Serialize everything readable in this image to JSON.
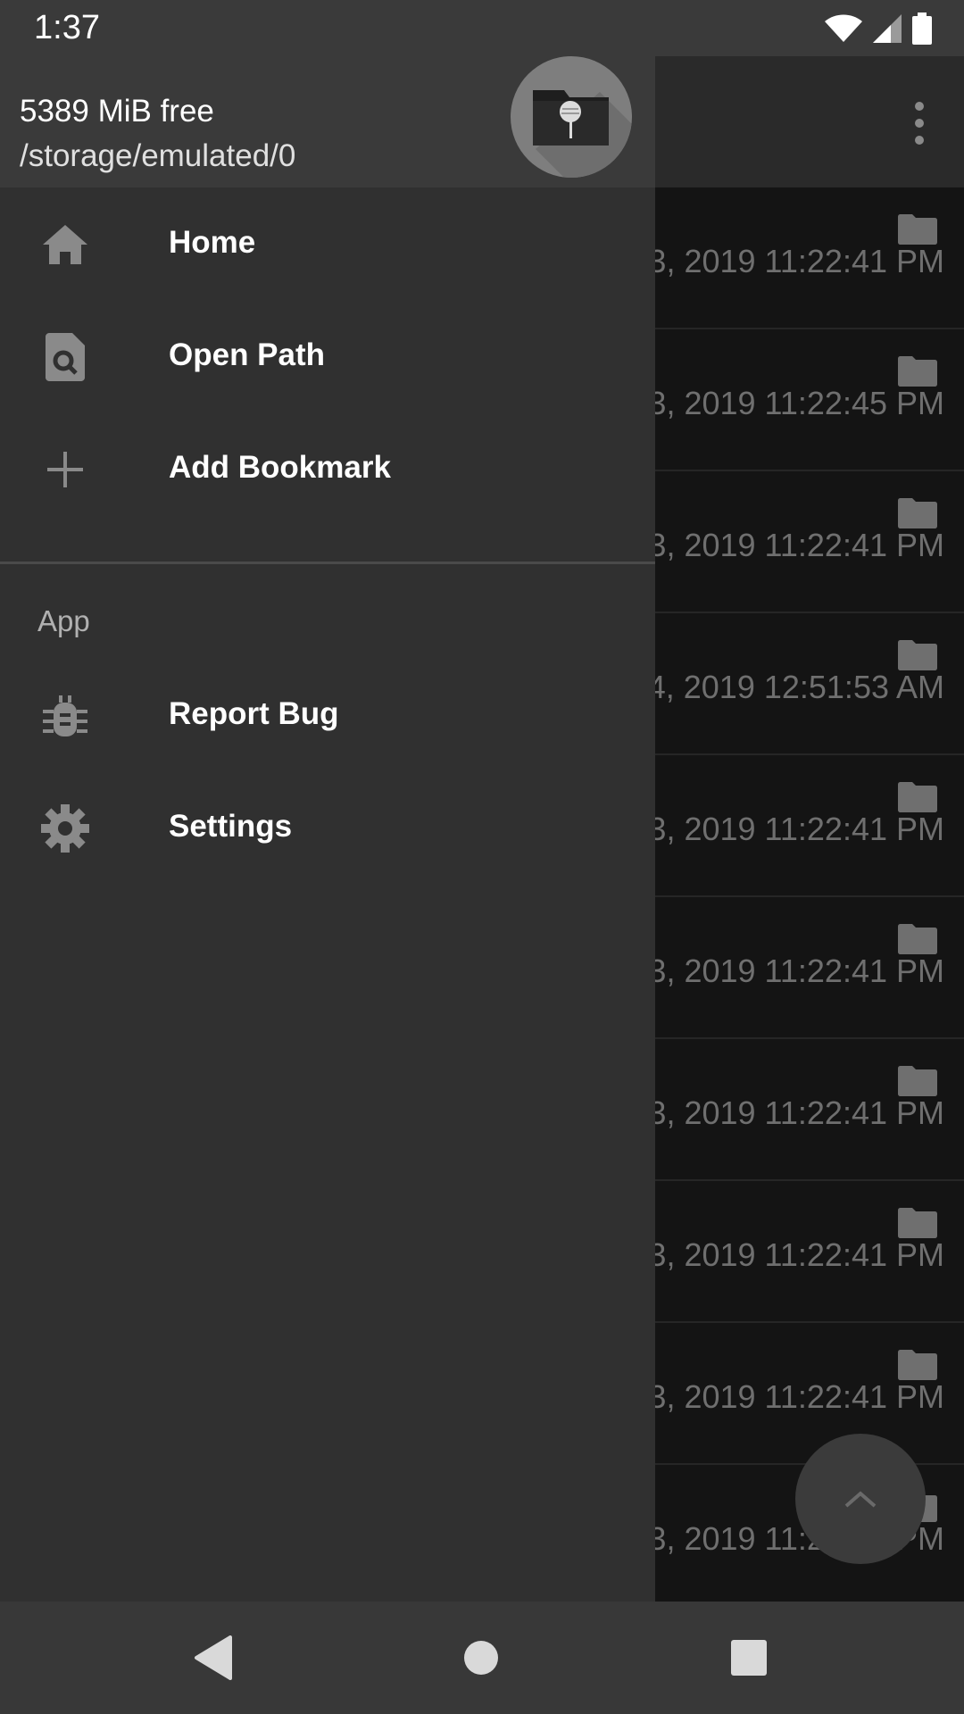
{
  "status_bar": {
    "time": "1:37",
    "icons": [
      "wifi-icon",
      "cellular-signal-icon",
      "battery-icon"
    ]
  },
  "app": {
    "overflow_icon": "more-vert-icon",
    "rows": [
      {
        "date": "3, 2019 11:22:41 PM",
        "icon": "folder-icon"
      },
      {
        "date": "3, 2019 11:22:45 PM",
        "icon": "folder-icon"
      },
      {
        "date": "3, 2019 11:22:41 PM",
        "icon": "folder-icon"
      },
      {
        "date": "4, 2019 12:51:53 AM",
        "icon": "folder-icon"
      },
      {
        "date": "3, 2019 11:22:41 PM",
        "icon": "folder-icon"
      },
      {
        "date": "3, 2019 11:22:41 PM",
        "icon": "folder-icon"
      },
      {
        "date": "3, 2019 11:22:41 PM",
        "icon": "folder-icon"
      },
      {
        "date": "3, 2019 11:22:41 PM",
        "icon": "folder-icon"
      },
      {
        "date": "3, 2019 11:22:41 PM",
        "icon": "folder-icon"
      },
      {
        "date": "3, 2019 11:22:41 PM",
        "icon": "folder-icon"
      }
    ],
    "fab_icon": "chevron-up-icon"
  },
  "drawer": {
    "free_space": "5389 MiB free",
    "path": "/storage/emulated/0",
    "items": [
      {
        "label": "Home",
        "icon": "home-icon"
      },
      {
        "label": "Open Path",
        "icon": "find-in-page-icon"
      },
      {
        "label": "Add Bookmark",
        "icon": "plus-icon"
      }
    ],
    "section_title": "App",
    "app_items": [
      {
        "label": "Report Bug",
        "icon": "bug-icon"
      },
      {
        "label": "Settings",
        "icon": "gear-icon"
      }
    ]
  },
  "colors": {
    "drawer_bg": "#303030",
    "header_bg": "#3a3a3a",
    "list_bg": "#141414",
    "icon_grey": "#8a8a8a"
  }
}
